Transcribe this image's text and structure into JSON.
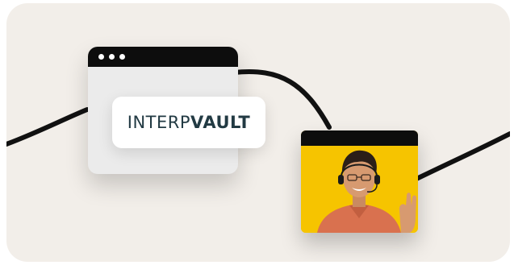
{
  "logo": {
    "part1": "INTERP",
    "part2": "VAULT"
  },
  "colors": {
    "background": "#f2eee9",
    "window_bar": "#0d0d0d",
    "logo_text": "#223a43",
    "video_background": "#f6c400"
  },
  "icons": [
    "window-dots-icon",
    "headset-person-photo"
  ]
}
